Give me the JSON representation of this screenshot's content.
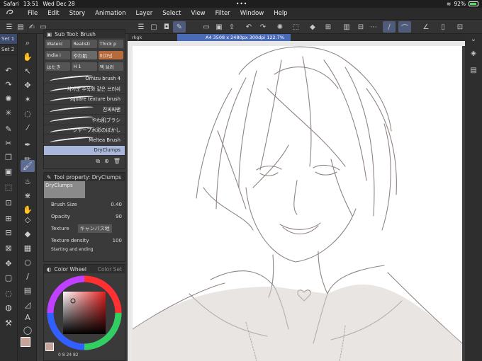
{
  "status_bar": {
    "app": "Safari",
    "time": "13:51",
    "date": "Wed Dec 28",
    "battery": "92%"
  },
  "menu": {
    "items": [
      "File",
      "Edit",
      "Story",
      "Animation",
      "Layer",
      "Select",
      "View",
      "Filter",
      "Window",
      "Help"
    ]
  },
  "sets": [
    "Set 1",
    "Set 2"
  ],
  "sub_tool": {
    "title": "Sub Tool: Brush",
    "chips_row1": [
      "Waterc",
      "Realisti",
      "Thick p"
    ],
    "chips_row2": [
      "India i",
      "やわ肌",
      "미끄덩"
    ],
    "chips_row3": [
      "はたき",
      "H 1",
      "액 브러"
    ],
    "brushes": [
      "Omizu brush 4",
      "차가운 수묵화 같은 브러쉬",
      "square texture brush",
      "진짜짜팬",
      "やわ肌ブラシ",
      "シャープ水彩のぼかし",
      "Meltea Brush",
      "DryClumps"
    ],
    "active_brush": "DryClumps"
  },
  "tool_property": {
    "title": "Tool property: DryClumps",
    "preset_name": "DryClumps",
    "brush_size_label": "Brush Size",
    "brush_size": "0.40",
    "opacity_label": "Opacity",
    "opacity": "90",
    "texture_label": "Texture",
    "texture_value": "キャンバス地",
    "texture_density_label": "Texture density",
    "texture_density": "100",
    "more_label": "Starting and ending"
  },
  "color_wheel": {
    "title": "Color Wheel",
    "title2": "Color Set",
    "main_color": "#c9a29a",
    "values": "0 8 24 82"
  },
  "canvas": {
    "tab_label": "rkgk",
    "doc_info": "A4 3508 x 2480px 300dpi 122.7%"
  }
}
